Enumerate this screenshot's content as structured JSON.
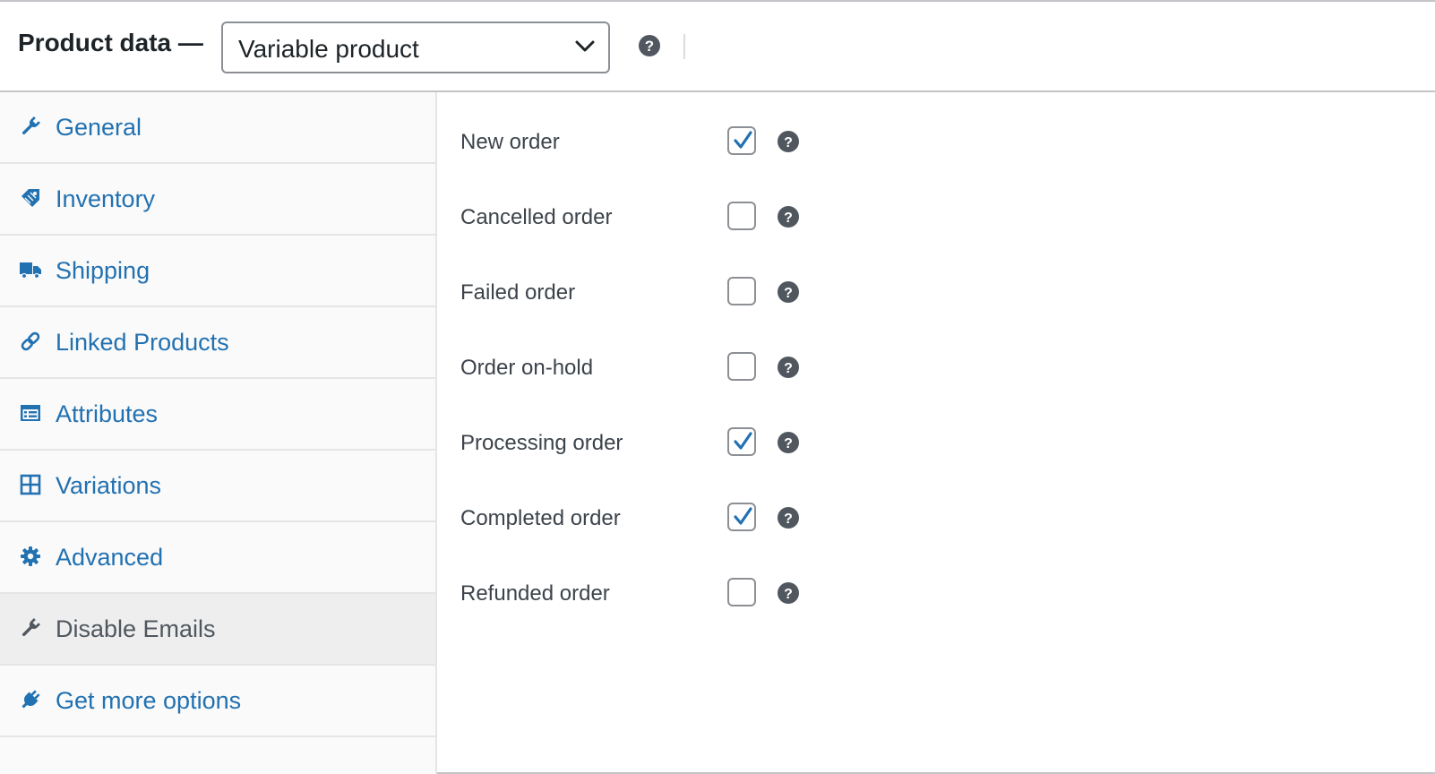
{
  "header": {
    "title": "Product data —",
    "product_type": "Variable product",
    "help_icon": "help-circle-icon",
    "dropdown_icon": "chevron-down-icon"
  },
  "tabs": [
    {
      "label": "General",
      "icon": "wrench-icon",
      "active": false
    },
    {
      "label": "Inventory",
      "icon": "tag-icon",
      "active": false
    },
    {
      "label": "Shipping",
      "icon": "truck-icon",
      "active": false
    },
    {
      "label": "Linked Products",
      "icon": "link-icon",
      "active": false
    },
    {
      "label": "Attributes",
      "icon": "list-view-icon",
      "active": false
    },
    {
      "label": "Variations",
      "icon": "grid-icon",
      "active": false
    },
    {
      "label": "Advanced",
      "icon": "gear-icon",
      "active": false
    },
    {
      "label": "Disable Emails",
      "icon": "wrench-icon",
      "active": true
    },
    {
      "label": "Get more options",
      "icon": "plugin-icon",
      "active": false
    }
  ],
  "email_options": [
    {
      "label": "New order",
      "checked": true
    },
    {
      "label": "Cancelled order",
      "checked": false
    },
    {
      "label": "Failed order",
      "checked": false
    },
    {
      "label": "Order on-hold",
      "checked": false
    },
    {
      "label": "Processing order",
      "checked": true
    },
    {
      "label": "Completed order",
      "checked": true
    },
    {
      "label": "Refunded order",
      "checked": false
    }
  ],
  "colors": {
    "link": "#2271b1",
    "active_tab_text": "#50575e",
    "active_tab_bg": "#eeeeee",
    "checkmark": "#2271b1",
    "help_icon": "#50575e"
  }
}
